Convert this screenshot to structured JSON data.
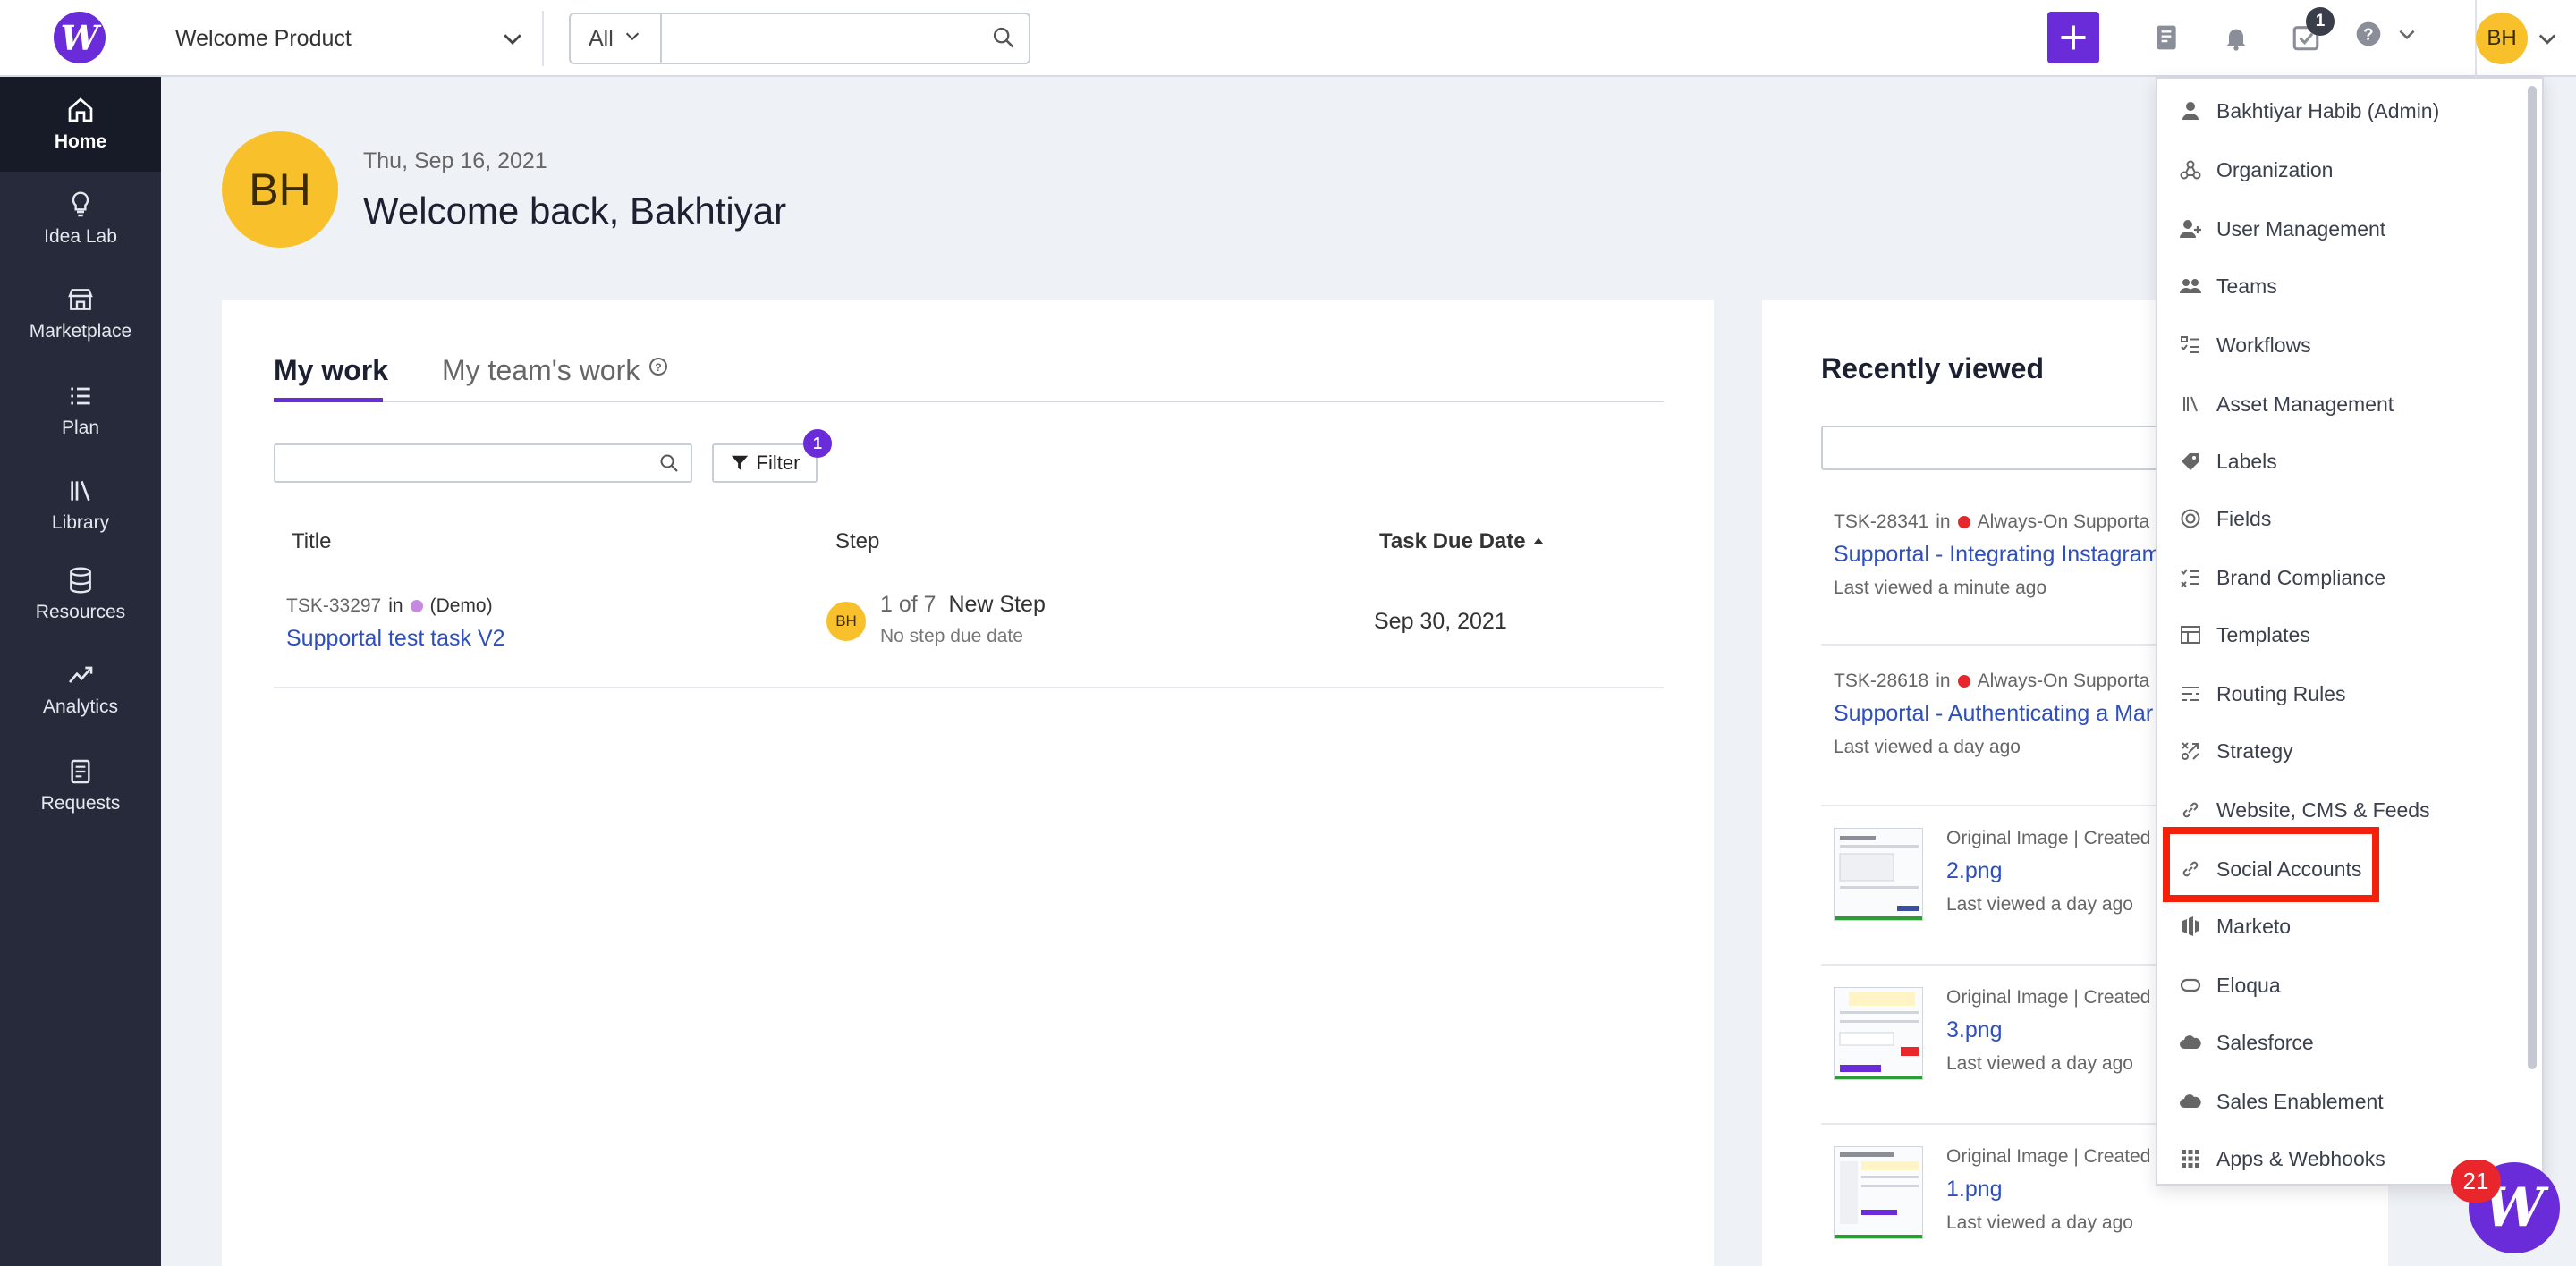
{
  "topbar": {
    "logo_letter": "W",
    "product": "Welcome Product",
    "search_scope": "All",
    "search_placeholder": "",
    "tasks_badge": "1",
    "user_initials": "BH"
  },
  "sidebar": {
    "items": [
      {
        "label": "Home",
        "icon": "home-icon"
      },
      {
        "label": "Idea Lab",
        "icon": "lightbulb-icon"
      },
      {
        "label": "Marketplace",
        "icon": "store-icon"
      },
      {
        "label": "Plan",
        "icon": "list-icon"
      },
      {
        "label": "Library",
        "icon": "library-icon"
      },
      {
        "label": "Resources",
        "icon": "database-icon"
      },
      {
        "label": "Analytics",
        "icon": "chart-icon"
      },
      {
        "label": "Requests",
        "icon": "document-icon"
      }
    ]
  },
  "greeting": {
    "initials": "BH",
    "date": "Thu, Sep 16, 2021",
    "title": "Welcome back, Bakhtiyar"
  },
  "work": {
    "tabs": [
      "My work",
      "My team's work"
    ],
    "filter_label": "Filter",
    "filter_count": "1",
    "columns": [
      "Title",
      "Step",
      "Task Due Date"
    ],
    "rows": [
      {
        "task_id": "TSK-33297",
        "in_label": "in",
        "project": "(Demo)",
        "project_color": "#c58ae0",
        "title": "Supportal test task V2",
        "step_initials": "BH",
        "step_progress": "1 of 7",
        "step_name": "New Step",
        "step_due": "No step due date",
        "due_date": "Sep 30, 2021"
      }
    ]
  },
  "recent": {
    "title": "Recently viewed",
    "items": [
      {
        "task_id": "TSK-28341",
        "in_label": "in",
        "project": "Always-On Supporta",
        "title": "Supportal - Integrating Instagram",
        "viewed": "Last viewed a minute ago"
      },
      {
        "task_id": "TSK-28618",
        "in_label": "in",
        "project": "Always-On Supporta",
        "title": "Supportal - Authenticating a Mar",
        "viewed": "Last viewed a day ago"
      }
    ],
    "assets": [
      {
        "meta": "Original Image  |  Created",
        "title": "2.png",
        "viewed": "Last viewed a day ago"
      },
      {
        "meta": "Original Image  |  Created",
        "title": "3.png",
        "viewed": "Last viewed a day ago"
      },
      {
        "meta": "Original Image  |  Created",
        "title": "1.png",
        "viewed": "Last viewed a day ago"
      }
    ]
  },
  "user_menu": {
    "items": [
      {
        "label": "Bakhtiyar Habib (Admin)",
        "icon": "person-icon"
      },
      {
        "label": "Organization",
        "icon": "organization-icon"
      },
      {
        "label": "User Management",
        "icon": "user-add-icon"
      },
      {
        "label": "Teams",
        "icon": "people-icon"
      },
      {
        "label": "Workflows",
        "icon": "workflow-icon"
      },
      {
        "label": "Asset Management",
        "icon": "library-icon"
      },
      {
        "label": "Labels",
        "icon": "tag-icon"
      },
      {
        "label": "Fields",
        "icon": "target-icon"
      },
      {
        "label": "Brand Compliance",
        "icon": "checklist-icon"
      },
      {
        "label": "Templates",
        "icon": "template-icon"
      },
      {
        "label": "Routing Rules",
        "icon": "sliders-icon"
      },
      {
        "label": "Strategy",
        "icon": "strategy-icon"
      },
      {
        "label": "Website, CMS & Feeds",
        "icon": "link-icon"
      },
      {
        "label": "Social Accounts",
        "icon": "link-icon"
      },
      {
        "label": "Marketo",
        "icon": "marketo-icon"
      },
      {
        "label": "Eloqua",
        "icon": "eloqua-icon"
      },
      {
        "label": "Salesforce",
        "icon": "cloud-icon"
      },
      {
        "label": "Sales Enablement",
        "icon": "cloud-icon"
      },
      {
        "label": "Apps & Webhooks",
        "icon": "grid-icon"
      }
    ]
  },
  "chat": {
    "letter": "W",
    "unread": "21"
  },
  "colors": {
    "brand": "#6a2bd9",
    "avatar": "#f8c12c",
    "sidebar": "#262a3b",
    "highlight": "#f4200a",
    "link": "#2d4fbf"
  }
}
